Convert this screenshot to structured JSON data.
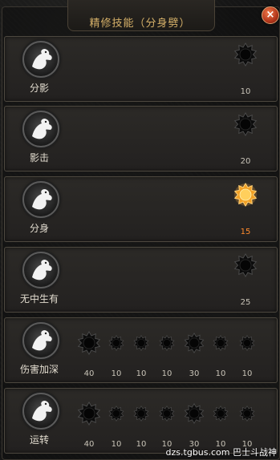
{
  "window": {
    "title": "精修技能（分身劈）",
    "close_glyph": "×"
  },
  "skills": [
    {
      "name": "分影",
      "icon": "white-dragon-icon",
      "nodes": [
        {
          "level": "10",
          "active": false,
          "kind": "large"
        }
      ]
    },
    {
      "name": "影击",
      "icon": "white-dragon-icon",
      "nodes": [
        {
          "level": "20",
          "active": false,
          "kind": "large"
        }
      ]
    },
    {
      "name": "分身",
      "icon": "white-dragon-icon",
      "nodes": [
        {
          "level": "15",
          "active": true,
          "kind": "large"
        }
      ]
    },
    {
      "name": "无中生有",
      "icon": "white-dragon-icon",
      "nodes": [
        {
          "level": "25",
          "active": false,
          "kind": "large"
        }
      ]
    },
    {
      "name": "伤害加深",
      "icon": "white-dragon-icon",
      "nodes": [
        {
          "level": "40",
          "active": false,
          "kind": "large"
        },
        {
          "level": "10",
          "active": false,
          "kind": "small"
        },
        {
          "level": "10",
          "active": false,
          "kind": "small"
        },
        {
          "level": "10",
          "active": false,
          "kind": "small"
        },
        {
          "level": "30",
          "active": false,
          "kind": "medium"
        },
        {
          "level": "10",
          "active": false,
          "kind": "small"
        },
        {
          "level": "10",
          "active": false,
          "kind": "small"
        }
      ]
    },
    {
      "name": "运转",
      "icon": "white-dragon-icon",
      "nodes": [
        {
          "level": "40",
          "active": false,
          "kind": "large"
        },
        {
          "level": "10",
          "active": false,
          "kind": "small"
        },
        {
          "level": "10",
          "active": false,
          "kind": "small"
        },
        {
          "level": "10",
          "active": false,
          "kind": "small"
        },
        {
          "level": "30",
          "active": false,
          "kind": "medium"
        },
        {
          "level": "10",
          "active": false,
          "kind": "small"
        },
        {
          "level": "10",
          "active": false,
          "kind": "small"
        }
      ]
    }
  ],
  "colors": {
    "title": "#d6b169",
    "active_level": "#ff8a2c",
    "active_node": "#f2a024"
  },
  "watermark": "dzs.tgbus.com 巴士斗战神"
}
